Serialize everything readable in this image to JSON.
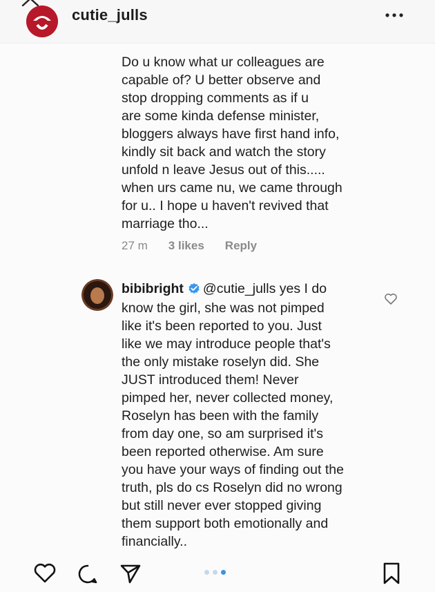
{
  "post": {
    "username": "cutie_julls"
  },
  "comment": {
    "lines": [
      "Do u know what ur colleagues are",
      "capable of? U better observe and",
      "stop dropping comments as if u",
      "are some kinda defense minister,",
      "bloggers always have first hand  info,",
      "kindly sit back and watch the story",
      "unfold n leave Jesus out of this.....",
      "when urs came nu, we came through",
      "for u.. I hope u haven't revived that",
      "marriage tho..."
    ],
    "time": "27 m",
    "likes": "3 likes",
    "reply_label": "Reply"
  },
  "reply": {
    "username": "bibibright",
    "mention": "@cutie_julls",
    "first_line_rest": " yes I do",
    "lines": [
      "know the girl, she was not pimped",
      "like it's been reported to you. Just",
      "like we may introduce people that's",
      "the only mistake roselyn did. She",
      "JUST introduced them! Never",
      "pimped her, never collected money,",
      "Roselyn has been with the family",
      "from day one, so am surprised it's",
      "been reported otherwise.  Am sure",
      "you have your ways of finding out the",
      "truth, pls do cs Roselyn did no wrong",
      "but still never ever stopped giving",
      "them support both emotionally and",
      "financially.."
    ]
  },
  "colors": {
    "verified": "#3897f0",
    "carousel_active": "#3793e8"
  },
  "icons": {
    "header": [
      "chevron-up-icon",
      "more-icon"
    ],
    "comment": [
      "heart-outline-icon",
      "verified-badge-icon"
    ],
    "footer": [
      "heart-icon",
      "comment-icon",
      "share-icon",
      "bookmark-icon"
    ]
  }
}
